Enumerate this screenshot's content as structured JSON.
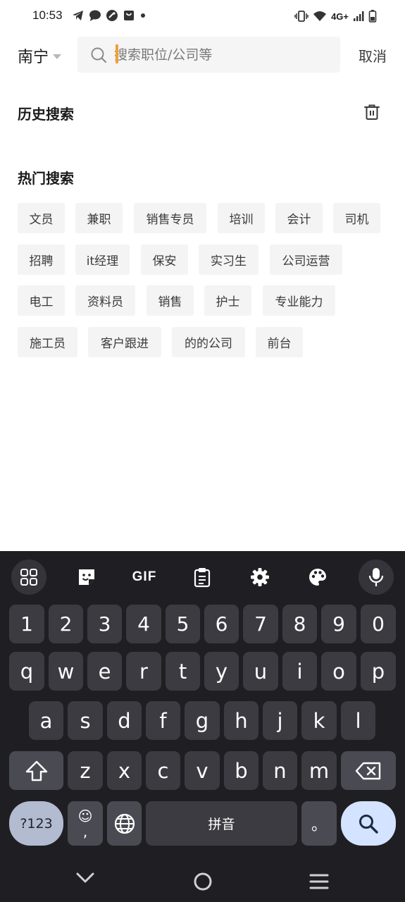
{
  "status_bar": {
    "time": "10:53",
    "network": "4G+",
    "icons_left": [
      "telegram-icon",
      "message-icon",
      "vpn-icon",
      "shopping-bag-icon",
      "dot-icon"
    ],
    "icons_right": [
      "vibrate-icon",
      "wifi-icon",
      "signal-icon",
      "battery-icon"
    ]
  },
  "search": {
    "city": "南宁",
    "placeholder": "搜索职位/公司等",
    "value": "",
    "cancel_label": "取消"
  },
  "history": {
    "title": "历史搜索",
    "clear_icon": "trash-icon"
  },
  "hot": {
    "title": "热门搜索",
    "tags": [
      "文员",
      "兼职",
      "销售专员",
      "培训",
      "会计",
      "司机",
      "招聘",
      "it经理",
      "保安",
      "实习生",
      "公司运营",
      "电工",
      "资料员",
      "销售",
      "护士",
      "专业能力",
      "施工员",
      "客户跟进",
      "的的公司",
      "前台"
    ]
  },
  "keyboard": {
    "toolbar": [
      "apps-grid-icon",
      "sticker-icon",
      "GIF",
      "clipboard-icon",
      "settings-gear-icon",
      "palette-icon",
      "microphone-icon"
    ],
    "row_numbers": [
      "1",
      "2",
      "3",
      "4",
      "5",
      "6",
      "7",
      "8",
      "9",
      "0"
    ],
    "row1": [
      "q",
      "w",
      "e",
      "r",
      "t",
      "y",
      "u",
      "i",
      "o",
      "p"
    ],
    "row2": [
      "a",
      "s",
      "d",
      "f",
      "g",
      "h",
      "j",
      "k",
      "l"
    ],
    "row3": [
      "z",
      "x",
      "c",
      "v",
      "b",
      "n",
      "m"
    ],
    "symbols_label": "?123",
    "emoji_top": "☺",
    "emoji_bottom": ",",
    "space_label": "拼音",
    "period_label": "。",
    "icons": [
      "shift-icon",
      "backspace-icon",
      "globe-icon",
      "search-icon"
    ]
  },
  "nav_bar": [
    "back-chevron-icon",
    "home-circle-icon",
    "recents-menu-icon"
  ],
  "colors": {
    "cursor": "#f0a035",
    "keyboard_bg": "#1f1f23",
    "key_bg": "#3b3b41",
    "symbols_key_bg": "#b2bbd0",
    "search_key_bg": "#d4e3ff"
  }
}
